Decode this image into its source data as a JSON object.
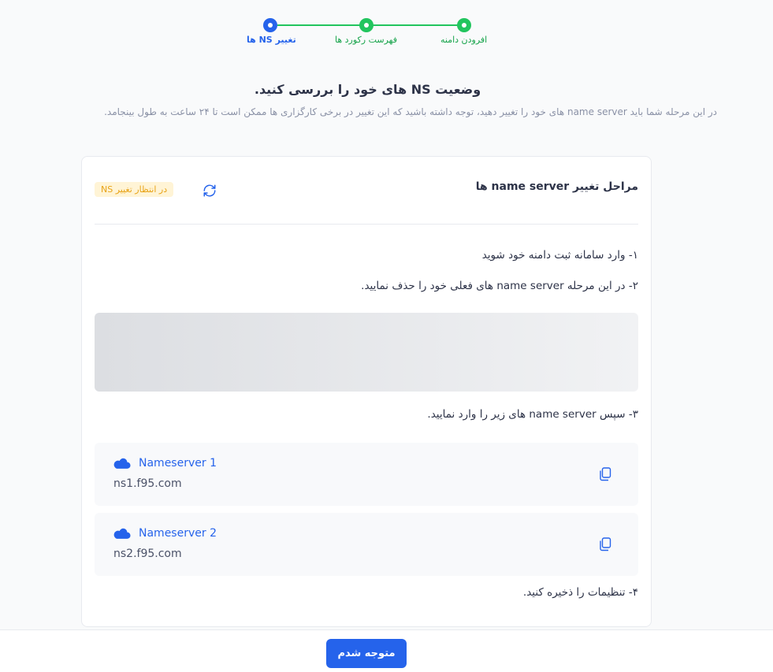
{
  "stepper": {
    "steps": [
      {
        "label": "افرودن دامنه",
        "state": "done"
      },
      {
        "label": "فهرست رکورد ها",
        "state": "done"
      },
      {
        "label": "تغییر NS ها",
        "state": "active"
      }
    ]
  },
  "heading": "وضعیت NS های خود را بررسی کنید.",
  "subtext": "در این مرحله شما باید name server های خود را تغییر دهید، توجه داشته باشید که این تغییر در برخی کارگزاری ها ممکن است تا ۲۴ ساعت به طول بینجامد.",
  "card": {
    "title": "مراحل تغییر name server ها",
    "status_badge": "در انتظار تغییر NS",
    "steps": [
      "۱- وارد سامانه ثبت دامنه خود شوید",
      "۲- در این مرحله name server های فعلی خود را حذف نمایید.",
      "۳- سپس name server های زیر را وارد نمایید.",
      "۴- تنظیمات را ذخیره کنید."
    ],
    "nameservers": [
      {
        "title": "Nameserver 1",
        "value": "ns1.f95.com"
      },
      {
        "title": "Nameserver 2",
        "value": "ns2.f95.com"
      }
    ]
  },
  "footer": {
    "confirm_label": "متوجه شدم"
  },
  "colors": {
    "accent": "#2563eb",
    "success": "#22c55e",
    "badge_bg": "#fff4d6",
    "badge_text": "#e8a317"
  },
  "icons": {
    "refresh": "refresh-icon",
    "cloud": "cloud-icon",
    "copy": "copy-icon"
  }
}
